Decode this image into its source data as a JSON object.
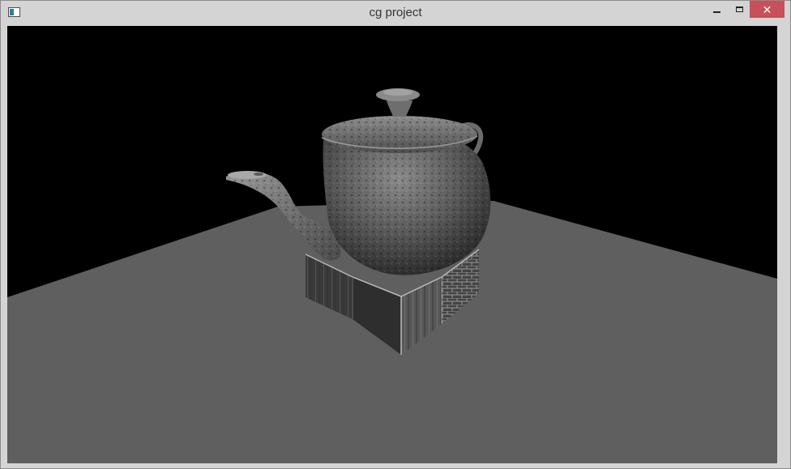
{
  "window": {
    "title": "cg project",
    "icon": "app-window-icon",
    "controls": {
      "minimize_icon": "minimize-icon",
      "maximize_icon": "maximize-icon",
      "close_icon": "close-icon",
      "close_glyph": "✕"
    }
  },
  "scene": {
    "background_color": "#000000",
    "floor_color": "#5f5f5f",
    "objects": [
      "teapot",
      "wooden-box-stand",
      "floor-plane"
    ]
  }
}
